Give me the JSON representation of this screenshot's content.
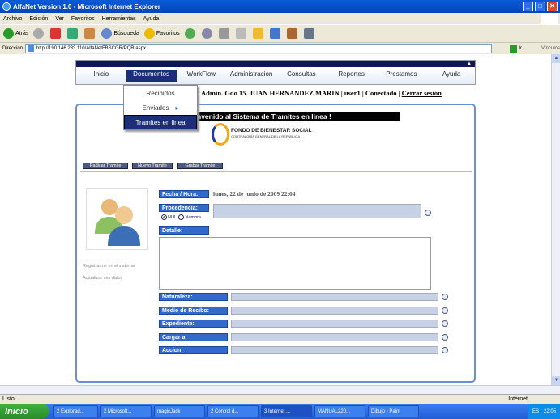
{
  "window": {
    "title": "AlfaNet Version 1.0 - Microsoft Internet Explorer",
    "controls": [
      "_",
      "□",
      "✕"
    ]
  },
  "menubar": [
    "Archivo",
    "Edición",
    "Ver",
    "Favoritos",
    "Herramientas",
    "Ayuda"
  ],
  "toolbar": {
    "back": "Atrás",
    "search": "Búsqueda",
    "favorites": "Favoritos"
  },
  "address": {
    "label": "Dirección",
    "url": "http://190.146.233.110/AlfaNetFBSCGR/PQR.aspx",
    "go": "Ir",
    "links": "Vínculos"
  },
  "nav": {
    "items": [
      "Inicio",
      "Documentos",
      "WorkFlow",
      "Administracion",
      "Consultas",
      "Reportes",
      "Prestamos",
      "Ayuda"
    ],
    "active": "Documentos"
  },
  "dropdown": [
    "Recibidos",
    "Enviados",
    "Tramites en linea"
  ],
  "user_line": {
    "text": "x. Admin. Gdo 15. JUAN HERNANDEZ MARIN | user1 | Conectado | ",
    "close": "Cerrar sesión"
  },
  "welcome": "nvenido al Sistema de Tramites en linea !",
  "logo": {
    "name": "FONDO DE BIENESTAR SOCIAL",
    "sub": "CONTRALORÍA GENERAL DE LA REPÚBLICA"
  },
  "actions": [
    "Radicar Tramite",
    "Nuevo Tramite",
    "Grabar Tramite"
  ],
  "side_links": [
    "Registrarme en el sistema",
    "Actualizar mis datos"
  ],
  "form": {
    "fecha_label": "Fecha / Hora:",
    "fecha_value": "lunes, 22 de junio de 2009 22:04",
    "procedencia_label": "Procedencia:",
    "radio_nui": "NUI",
    "radio_nombre": "Nombre",
    "detalle_label": "Detalle:",
    "fields": [
      "Naturaleza:",
      "Medio de Recibo:",
      "Expediente:",
      "Cargar a:",
      "Accion:"
    ]
  },
  "status": {
    "left": "Listo",
    "zone": "Internet"
  },
  "taskbar": {
    "start": "Inicio",
    "tasks": [
      "2 Explorad...",
      "2 Microsoft...",
      "magicJack",
      "2 Control d...",
      "3 Internet ...",
      "MANUAL220...",
      "Dibujo - Paint"
    ],
    "lang": "ES",
    "clock": "22:05"
  }
}
